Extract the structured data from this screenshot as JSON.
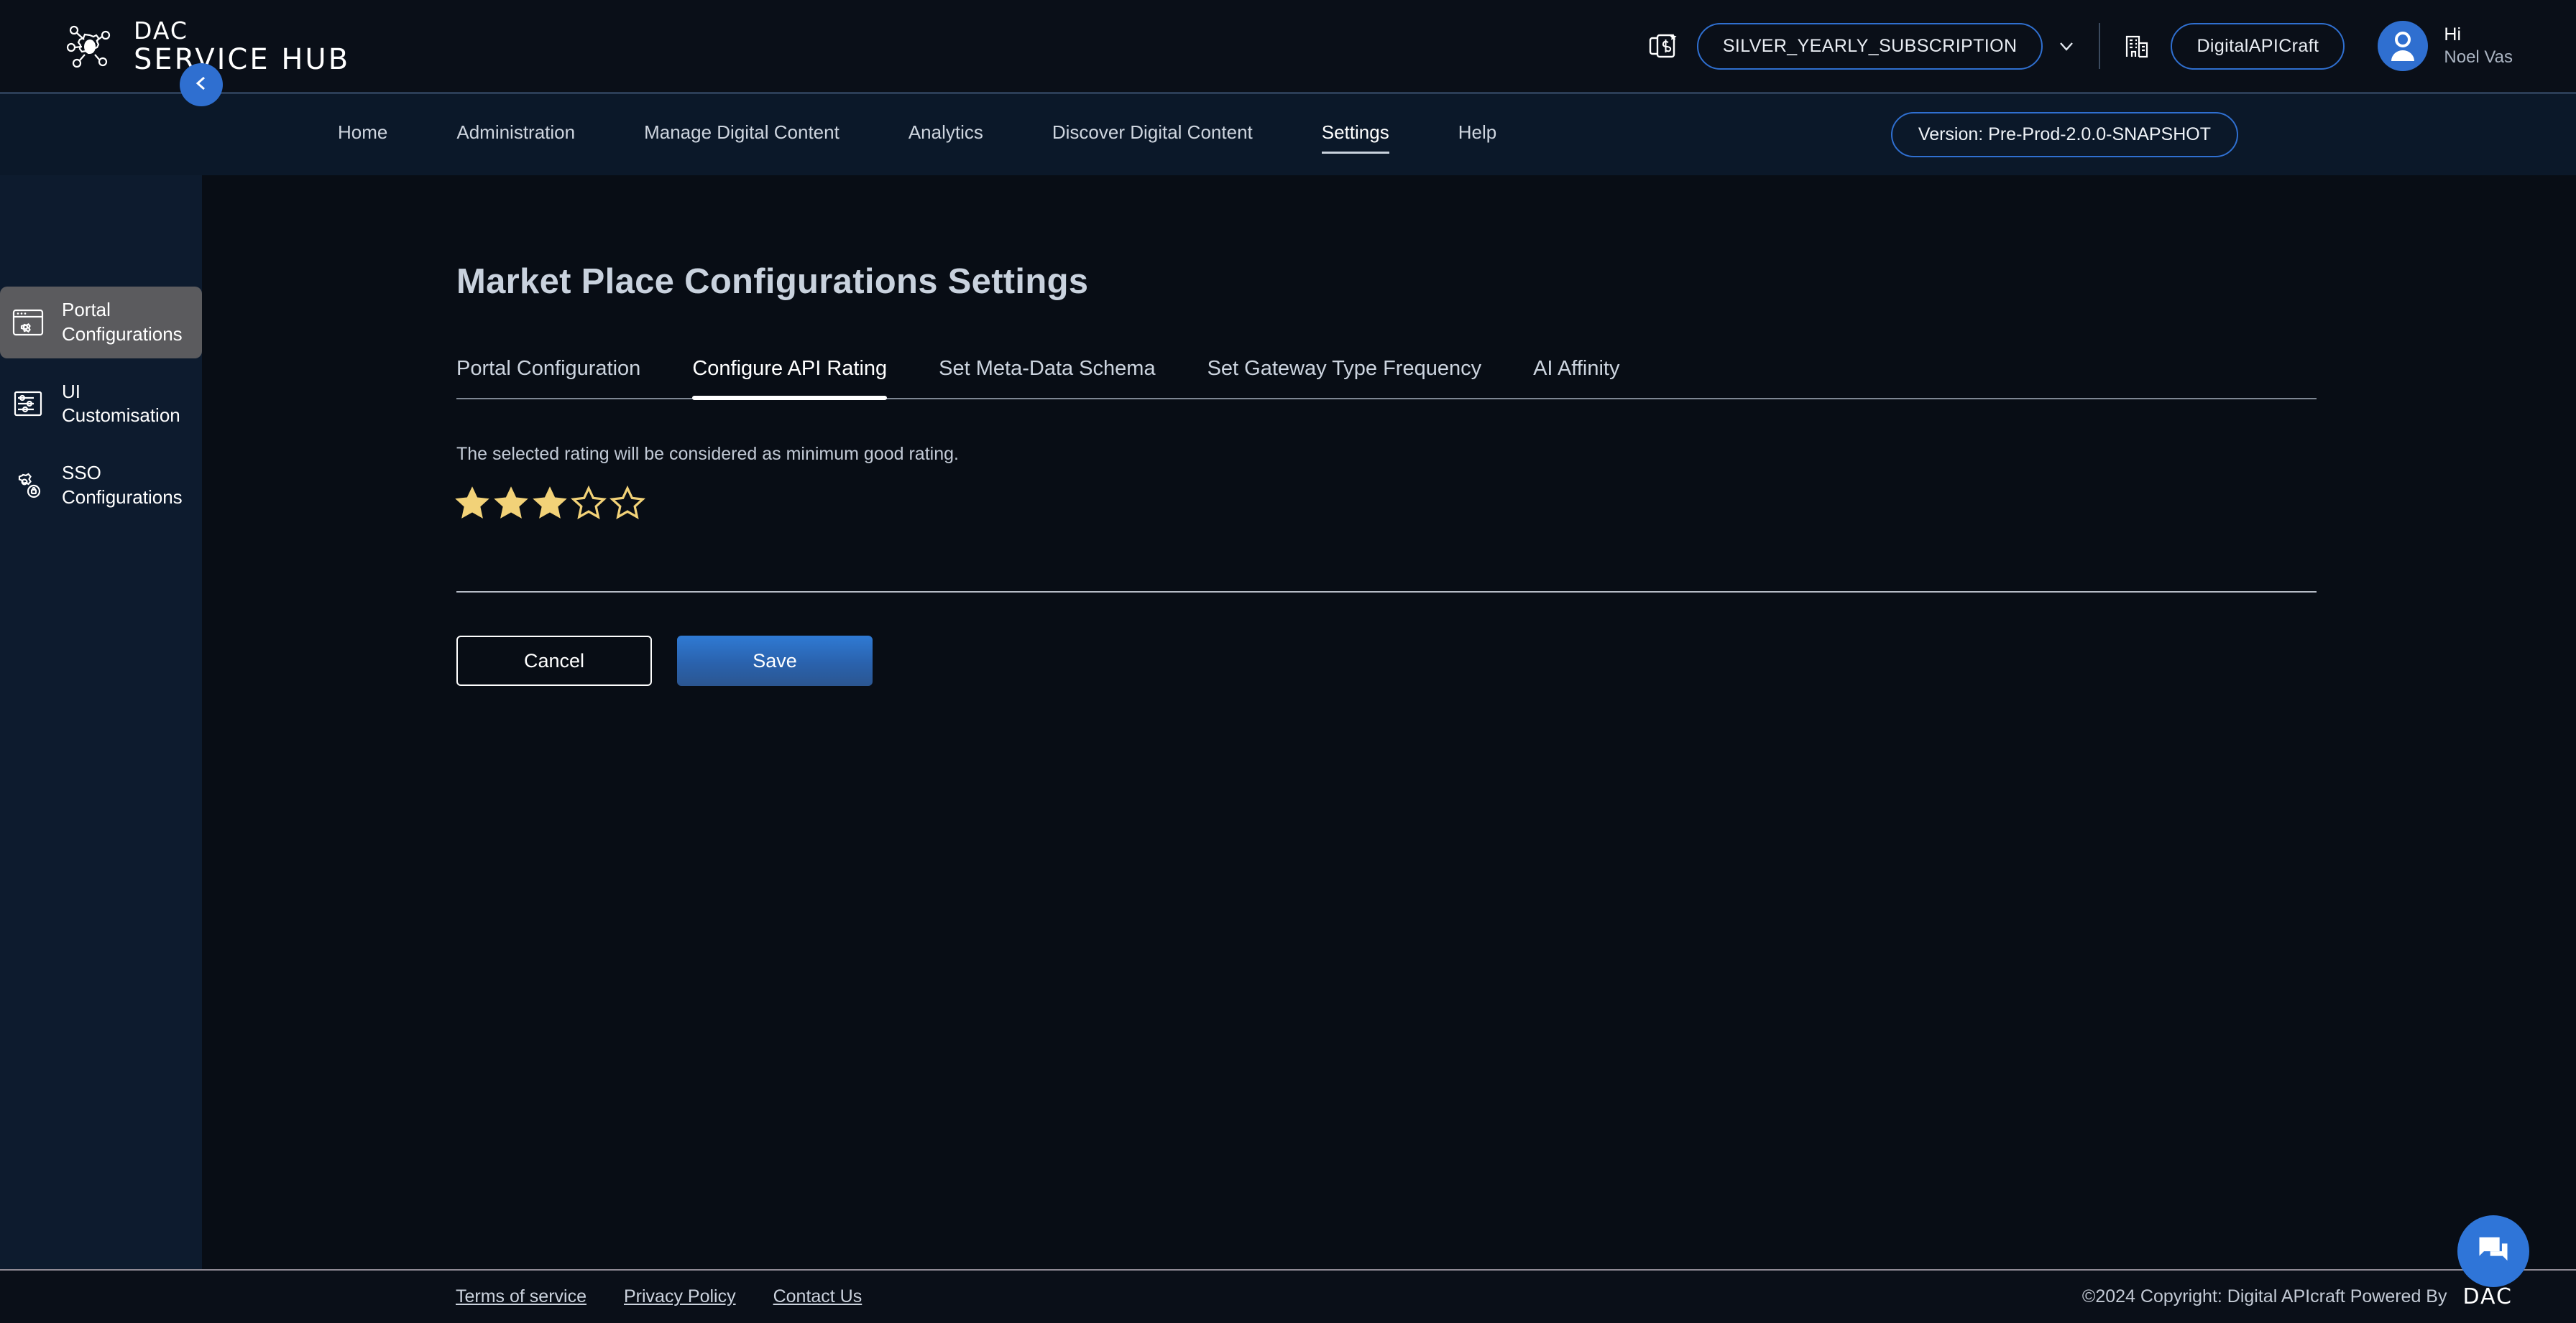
{
  "header": {
    "logo_line1": "DAC",
    "logo_line2": "SERVICE HUB",
    "logo_icon": "gear-molecule-icon",
    "subscription_icon": "subscription-card-icon",
    "subscription_label": "SILVER_YEARLY_SUBSCRIPTION",
    "chevron_icon": "chevron-down-icon",
    "org_icon": "building-icon",
    "org_label": "DigitalAPICraft",
    "avatar_icon": "user-avatar-icon",
    "greeting": "Hi",
    "user_name": "Noel Vas"
  },
  "nav": {
    "items": [
      {
        "label": "Home",
        "active": false
      },
      {
        "label": "Administration",
        "active": false
      },
      {
        "label": "Manage Digital Content",
        "active": false
      },
      {
        "label": "Analytics",
        "active": false
      },
      {
        "label": "Discover Digital Content",
        "active": false
      },
      {
        "label": "Settings",
        "active": true
      },
      {
        "label": "Help",
        "active": false
      }
    ],
    "version_label": "Version: Pre-Prod-2.0.0-SNAPSHOT"
  },
  "sidebar": {
    "collapse_icon": "chevron-left-icon",
    "items": [
      {
        "label_line1": "Portal",
        "label_line2": "Configurations",
        "icon": "browser-gear-icon",
        "active": true
      },
      {
        "label_line1": "UI",
        "label_line2": "Customisation",
        "icon": "sliders-icon",
        "active": false
      },
      {
        "label_line1": "SSO",
        "label_line2": "Configurations",
        "icon": "gear-lock-icon",
        "active": false
      }
    ]
  },
  "main": {
    "title": "Market Place Configurations Settings",
    "tabs": [
      {
        "label": "Portal Configuration",
        "active": false
      },
      {
        "label": "Configure API Rating",
        "active": true
      },
      {
        "label": "Set Meta-Data Schema",
        "active": false
      },
      {
        "label": "Set Gateway Type Frequency",
        "active": false
      },
      {
        "label": "AI Affinity",
        "active": false
      }
    ],
    "hint": "The selected rating will be considered as minimum good rating.",
    "rating": {
      "value": 3,
      "max": 5,
      "star_color": "#f2d278"
    },
    "cancel_label": "Cancel",
    "save_label": "Save"
  },
  "footer": {
    "links": [
      {
        "label": "Terms of service"
      },
      {
        "label": "Privacy Policy"
      },
      {
        "label": "Contact Us"
      }
    ],
    "copyright": "©2024 Copyright: Digital APIcraft Powered By",
    "brand": "DAC"
  },
  "chat": {
    "icon": "chat-bubbles-icon"
  },
  "theme": {
    "accent_blue": "#2f6fd0",
    "header_bg": "#0a0f18",
    "nav_bg": "#0b1829",
    "sidebar_bg": "#0d1b2e",
    "main_bg": "#080d15",
    "star_gold": "#f2d278"
  }
}
